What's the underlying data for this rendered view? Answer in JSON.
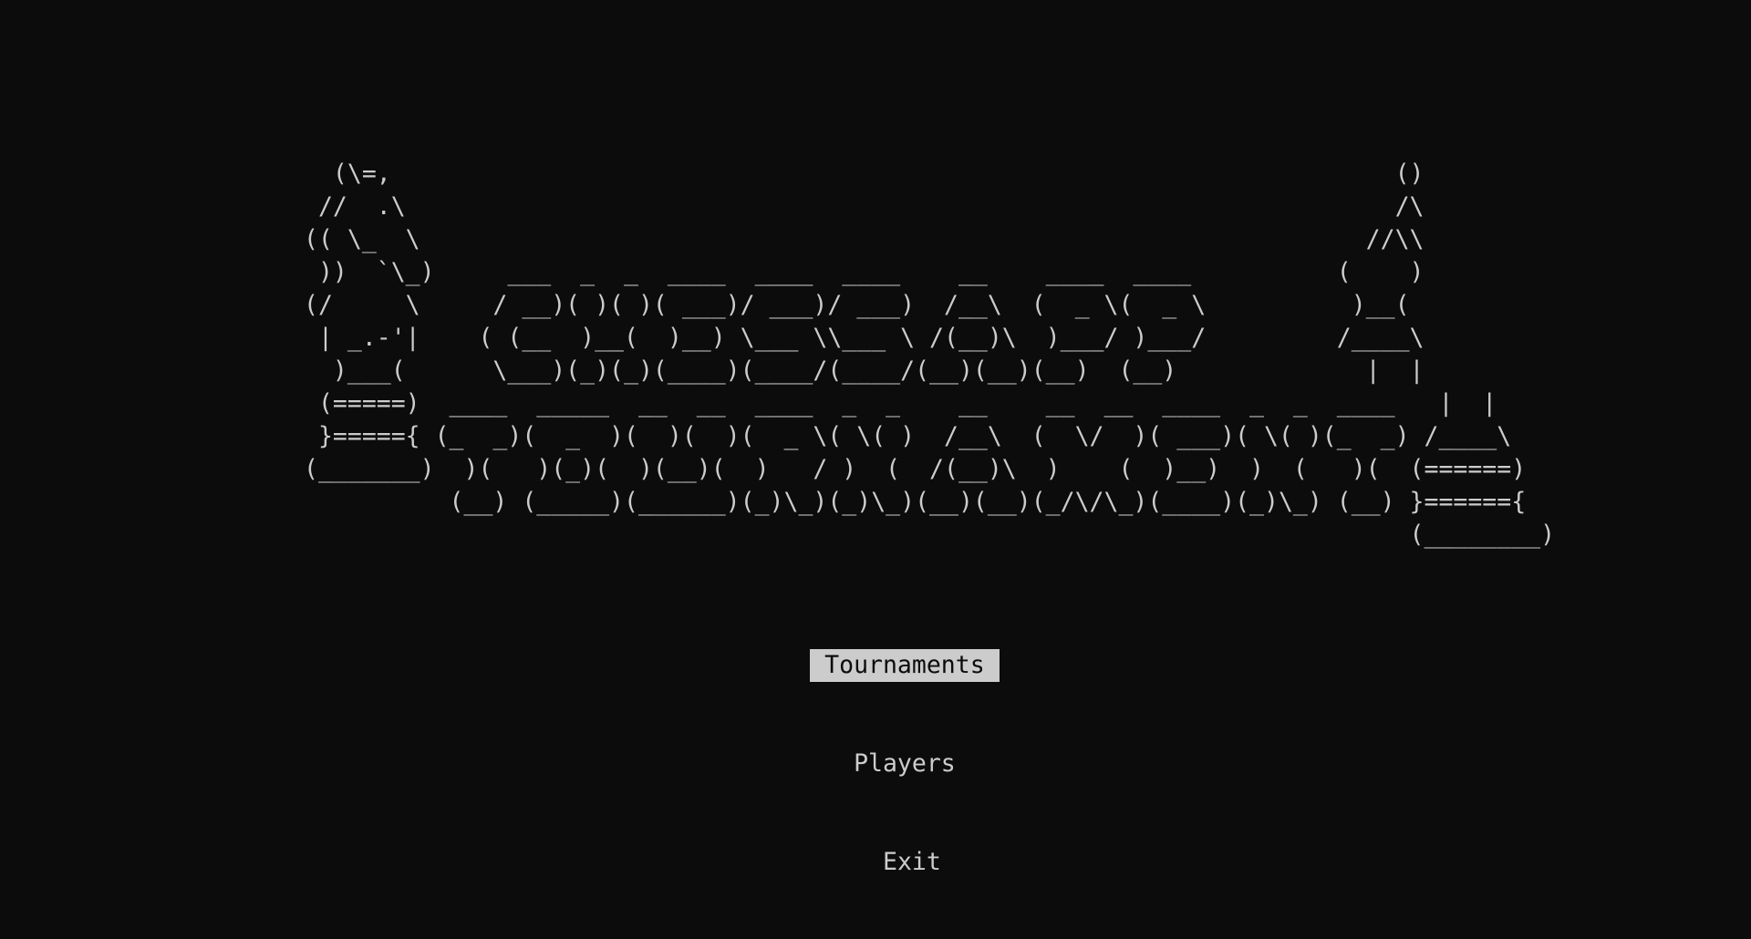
{
  "banner": {
    "ascii_art": "  (\\=,                                                                     ()\n //  .\\                                                                    /\\\n(( \\_  \\                                                                 //\\\\\n ))  `\\_)     ___  _  _  ____  ____  ____    __    ____  ____          (    )\n(/     \\     / __)( )( )( ___)/ ___)/ ___)  /__\\  (  _ \\(  _ \\          )__(\n | _.-'|    ( (__  )__(  )__) \\___ \\\\___ \\ /(__)\\  )___/ )___/         /____\\\n  )___(      \\___)(_)(_)(____)(____/(____/(__)(__)(__)  (__)             |  |\n (=====)  ____  _____  __  __  ____  _  _    __    __  __  ____  _  _  ____   |  |\n }====={ (_  _)(  _  )(  )(  )(  _ \\( \\( )  /__\\  (  \\/  )( ___)( \\( )(_  _) /____\\\n(_______)  )(   )(_)(  )(__)(  )   / )  (  /(__)\\  )    (  )__)  )  (   )(  (======)\n          (__) (_____)(______)(_)\\_)(_)\\_)(__)(__)(_/\\/\\_)(____)(_)\\_) (__) }======{\n                                                                            (________)"
  },
  "menu": {
    "items": [
      {
        "label": "Tournaments",
        "selected": true
      },
      {
        "label": "Players",
        "selected": false
      },
      {
        "label": "Exit",
        "selected": false
      }
    ]
  },
  "colors": {
    "background": "#0c0c0c",
    "foreground": "#cccccc",
    "highlight_bg": "#cccccc",
    "highlight_fg": "#0c0c0c"
  }
}
